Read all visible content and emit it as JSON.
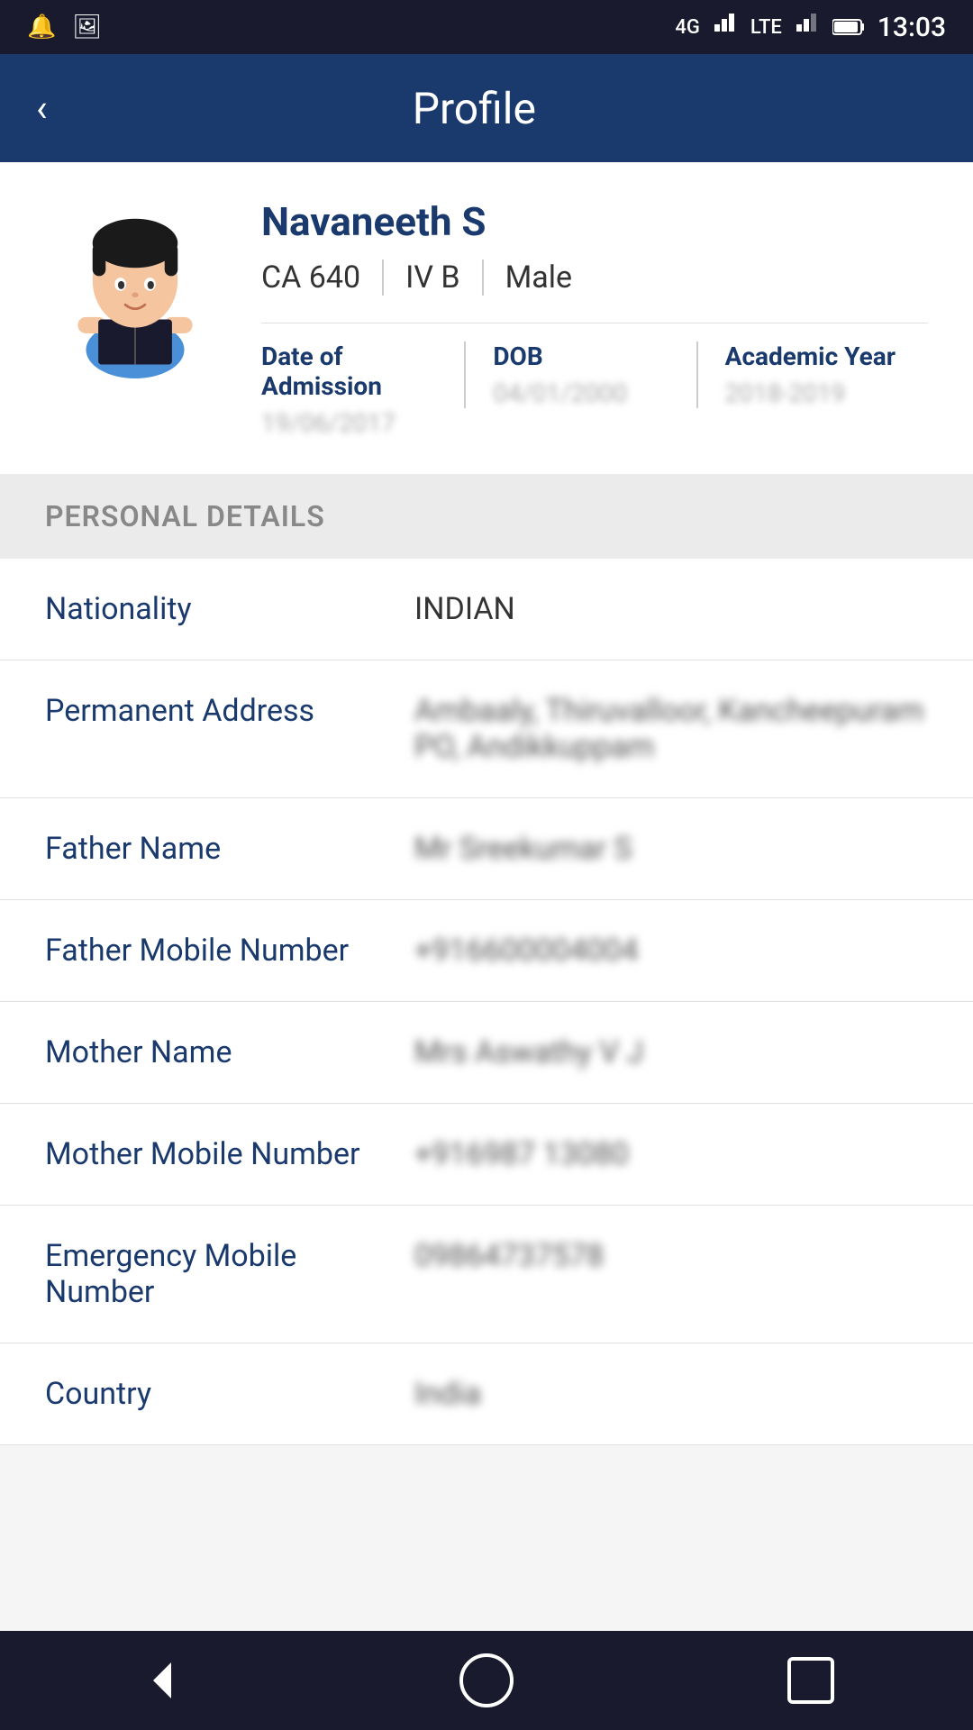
{
  "statusBar": {
    "time": "13:03",
    "icons": [
      "notification",
      "image",
      "phone",
      "signal4g",
      "lte",
      "signal",
      "battery"
    ]
  },
  "header": {
    "backLabel": "<",
    "title": "Profile"
  },
  "profile": {
    "name": "Navaneeth S",
    "rollNumber": "CA 640",
    "class": "IV B",
    "gender": "Male",
    "avatarAlt": "Student avatar"
  },
  "dateSection": {
    "items": [
      {
        "label": "Date of Admission",
        "value": "19/06/2017",
        "blurred": true
      },
      {
        "label": "DOB",
        "value": "04/01/2000",
        "blurred": true
      },
      {
        "label": "Academic Year",
        "value": "2018-2019",
        "blurred": true
      }
    ]
  },
  "personalDetails": {
    "sectionTitle": "PERSONAL DETAILS",
    "rows": [
      {
        "label": "Nationality",
        "value": "INDIAN",
        "blurred": false
      },
      {
        "label": "Permanent Address",
        "value": "Ambaaly, Thiruvalloor, Kancheepuram PO, Andikkuppam",
        "blurred": true
      },
      {
        "label": "Father Name",
        "value": "Mr Sreekumar S",
        "blurred": true
      },
      {
        "label": "Father Mobile Number",
        "value": "+916600004004",
        "blurred": true
      },
      {
        "label": "Mother Name",
        "value": "Mrs Aswathy V J",
        "blurred": true
      },
      {
        "label": "Mother Mobile Number",
        "value": "+916987 13080",
        "blurred": true
      },
      {
        "label": "Emergency Mobile Number",
        "value": "09864737578",
        "blurred": true
      },
      {
        "label": "Country",
        "value": "India",
        "blurred": true
      }
    ]
  },
  "bottomNav": {
    "back": "◁",
    "home": "",
    "recent": ""
  }
}
